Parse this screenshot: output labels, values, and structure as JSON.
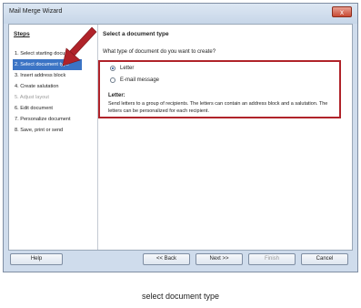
{
  "window": {
    "title": "Mail Merge Wizard",
    "close_label": "x"
  },
  "steps": {
    "heading": "Steps",
    "items": [
      {
        "label": "1. Select starting document",
        "state": "normal"
      },
      {
        "label": "2. Select document type",
        "state": "active"
      },
      {
        "label": "3. Insert address block",
        "state": "normal"
      },
      {
        "label": "4. Create salutation",
        "state": "normal"
      },
      {
        "label": "5. Adjust layout",
        "state": "disabled"
      },
      {
        "label": "6. Edit document",
        "state": "normal"
      },
      {
        "label": "7. Personalize document",
        "state": "normal"
      },
      {
        "label": "8. Save, print or send",
        "state": "normal"
      }
    ]
  },
  "content": {
    "heading": "Select a document type",
    "question": "What type of document do you want to create?",
    "options": {
      "letter": {
        "label": "Letter",
        "checked": true
      },
      "email": {
        "label": "E-mail message",
        "checked": false
      }
    },
    "description_title": "Letter:",
    "description_text": "Send letters to a group of recipients. The letters can contain an address block and a salutation. The letters can be personalized for each recipient."
  },
  "buttons": {
    "help": "Help",
    "back": "<< Back",
    "next": "Next >>",
    "finish": "Finish",
    "cancel": "Cancel"
  },
  "colors": {
    "highlight_border": "#b0232a",
    "arrow": "#b0232a",
    "active_step": "#3b74c5"
  },
  "caption": "select document type"
}
